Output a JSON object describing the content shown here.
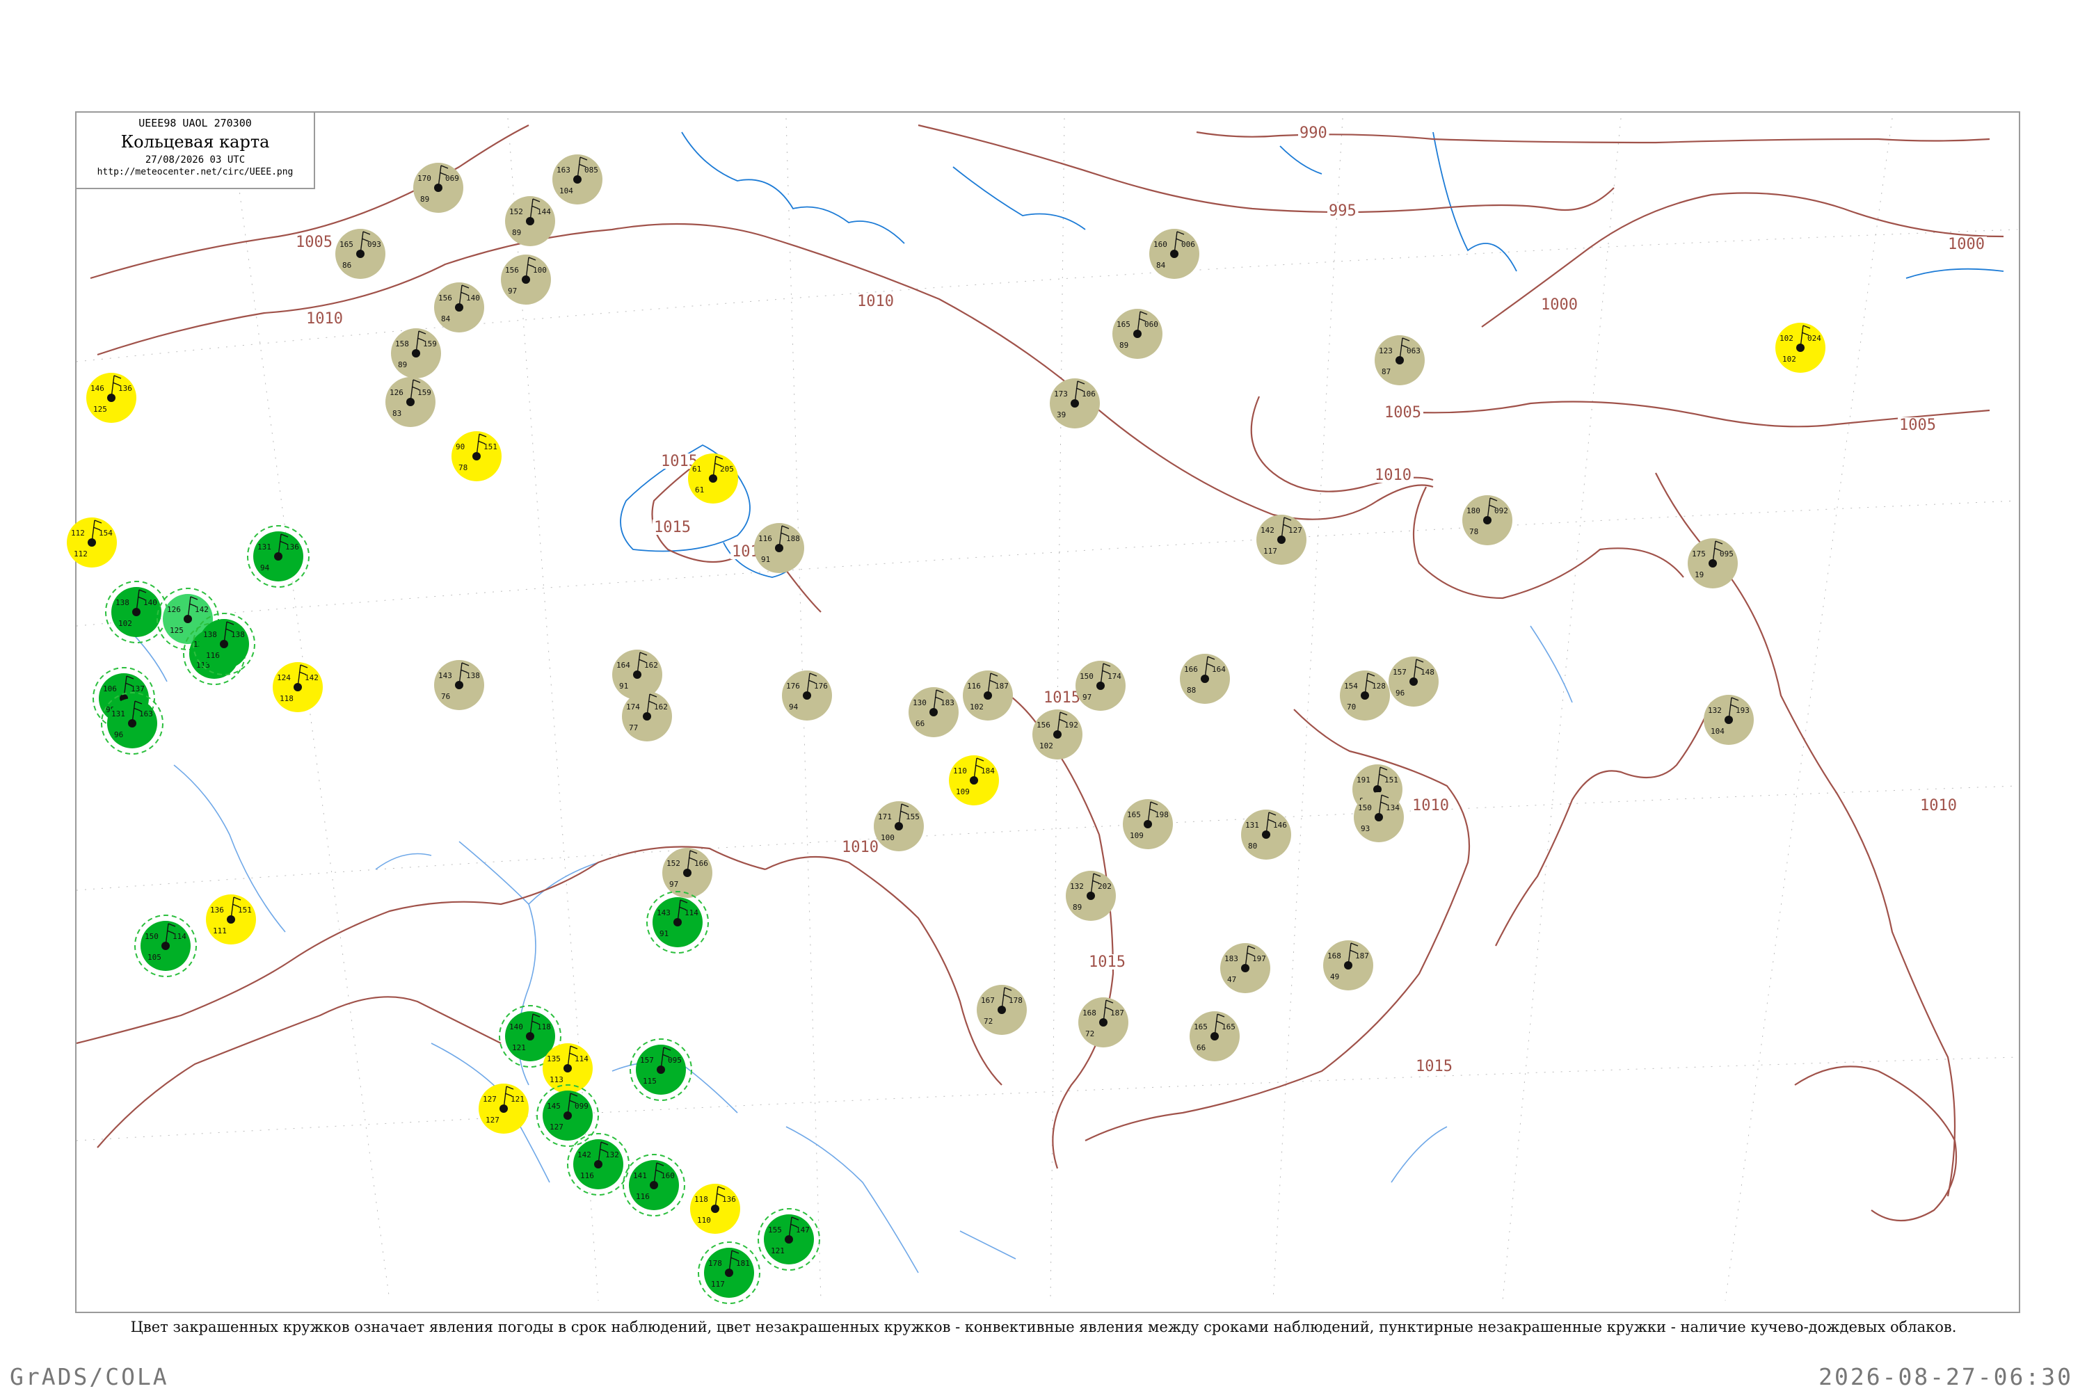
{
  "title_box": {
    "code": "UEEE98  UAOL  270300",
    "name": "Кольцевая карта",
    "date": "27/08/2026 03 UTC",
    "url": "http://meteocenter.net/circ/UEEE.png"
  },
  "caption": "Цвет закрашенных кружков означает явления погоды в срок наблюдений, цвет незакрашенных кружков - конвективные явления между сроками наблюдений, пунктирные незакрашенные кружки - наличие кучево-дождевых облаков.",
  "footer": {
    "left": "GrADS/COLA",
    "right": "2026-08-27-06:30"
  },
  "colors": {
    "isobar": "#a0524a",
    "coast": "#1c7bd6",
    "river": "#6fa8e8",
    "olive_circle": "#c4c094",
    "yellow_circle": "#fff200",
    "green_circle": "#00b026",
    "light_green_circle": "#3ed66a",
    "dashed_circle": "#2cbf3e"
  },
  "isobar_labels": [
    "990",
    "995",
    "1000",
    "1000",
    "1005",
    "1005",
    "1005",
    "1010",
    "1010",
    "1010",
    "1010",
    "1010",
    "1015",
    "1015",
    "1015",
    "1015",
    "1015",
    "1015",
    "1010"
  ],
  "stations": [
    {
      "kind": "olive",
      "p": "170",
      "t": "069",
      "td": "89"
    },
    {
      "kind": "olive",
      "p": "163",
      "t": "085",
      "td": "104"
    },
    {
      "kind": "olive",
      "p": "165",
      "t": "093",
      "td": "86"
    },
    {
      "kind": "olive",
      "p": "152",
      "t": "144",
      "td": "89"
    },
    {
      "kind": "olive",
      "p": "156",
      "t": "100",
      "td": "97"
    },
    {
      "kind": "olive",
      "p": "156",
      "t": "140",
      "td": "84"
    },
    {
      "kind": "olive",
      "p": "158",
      "t": "159",
      "td": "89"
    },
    {
      "kind": "olive",
      "p": "126",
      "t": "159",
      "td": "83"
    },
    {
      "kind": "yellow",
      "p": "90",
      "t": "151",
      "td": "78"
    },
    {
      "kind": "yellow",
      "p": "61",
      "t": "205",
      "td": "61"
    },
    {
      "kind": "olive",
      "p": "116",
      "t": "188",
      "td": "91"
    },
    {
      "kind": "olive",
      "p": "160",
      "t": "006",
      "td": "84"
    },
    {
      "kind": "olive",
      "p": "165",
      "t": "060",
      "td": "89"
    },
    {
      "kind": "olive",
      "p": "173",
      "t": "106",
      "td": "39"
    },
    {
      "kind": "olive",
      "p": "142",
      "t": "127",
      "td": "117"
    },
    {
      "kind": "olive",
      "p": "123",
      "t": "063",
      "td": "87"
    },
    {
      "kind": "yellow",
      "p": "102",
      "t": "024",
      "td": "102"
    },
    {
      "kind": "olive",
      "p": "180",
      "t": "092",
      "td": "78"
    },
    {
      "kind": "olive",
      "p": "175",
      "t": "095",
      "td": "19"
    },
    {
      "kind": "yellow",
      "p": "112",
      "t": "154",
      "td": "112"
    },
    {
      "kind": "yellow",
      "p": "146",
      "t": "136",
      "td": "125"
    },
    {
      "kind": "green",
      "p": "131",
      "t": "136",
      "td": "94"
    },
    {
      "kind": "green",
      "p": "138",
      "t": "140",
      "td": "102"
    },
    {
      "kind": "lightgreen",
      "p": "126",
      "t": "142",
      "td": "125"
    },
    {
      "kind": "green",
      "p": "132",
      "t": "135",
      "td": "113"
    },
    {
      "kind": "green",
      "p": "138",
      "t": "138",
      "td": "116"
    },
    {
      "kind": "yellow",
      "p": "124",
      "t": "142",
      "td": "118"
    },
    {
      "kind": "green",
      "p": "106",
      "t": "137",
      "td": "98"
    },
    {
      "kind": "green",
      "p": "131",
      "t": "163",
      "td": "96"
    },
    {
      "kind": "olive",
      "p": "164",
      "t": "162",
      "td": "91"
    },
    {
      "kind": "olive",
      "p": "174",
      "t": "162",
      "td": "77"
    },
    {
      "kind": "olive",
      "p": "143",
      "t": "138",
      "td": "76"
    },
    {
      "kind": "olive",
      "p": "176",
      "t": "176",
      "td": "94"
    },
    {
      "kind": "olive",
      "p": "130",
      "t": "183",
      "td": "66"
    },
    {
      "kind": "olive",
      "p": "116",
      "t": "187",
      "td": "102"
    },
    {
      "kind": "olive",
      "p": "150",
      "t": "174",
      "td": "97"
    },
    {
      "kind": "olive",
      "p": "166",
      "t": "164",
      "td": "88"
    },
    {
      "kind": "olive",
      "p": "156",
      "t": "192",
      "td": "102"
    },
    {
      "kind": "yellow",
      "p": "110",
      "t": "184",
      "td": "109"
    },
    {
      "kind": "olive",
      "p": "171",
      "t": "155",
      "td": "100"
    },
    {
      "kind": "olive",
      "p": "165",
      "t": "198",
      "td": "109"
    },
    {
      "kind": "olive",
      "p": "132",
      "t": "202",
      "td": "89"
    },
    {
      "kind": "olive",
      "p": "152",
      "t": "166",
      "td": "97"
    },
    {
      "kind": "green",
      "p": "143",
      "t": "114",
      "td": "91"
    },
    {
      "kind": "yellow",
      "p": "136",
      "t": "151",
      "td": "111"
    },
    {
      "kind": "green",
      "p": "150",
      "t": "114",
      "td": "105"
    },
    {
      "kind": "olive",
      "p": "183",
      "t": "197",
      "td": "47"
    },
    {
      "kind": "olive",
      "p": "168",
      "t": "187",
      "td": "49"
    },
    {
      "kind": "olive",
      "p": "168",
      "t": "187",
      "td": "72"
    },
    {
      "kind": "olive",
      "p": "165",
      "t": "165",
      "td": "66"
    },
    {
      "kind": "olive",
      "p": "167",
      "t": "178",
      "td": "72"
    },
    {
      "kind": "olive",
      "p": "191",
      "t": "151",
      "td": "88"
    },
    {
      "kind": "olive",
      "p": "150",
      "t": "134",
      "td": "93"
    },
    {
      "kind": "olive",
      "p": "157",
      "t": "148",
      "td": "96"
    },
    {
      "kind": "olive",
      "p": "131",
      "t": "146",
      "td": "80"
    },
    {
      "kind": "olive",
      "p": "132",
      "t": "193",
      "td": "104"
    },
    {
      "kind": "olive",
      "p": "154",
      "t": "128",
      "td": "70"
    },
    {
      "kind": "green",
      "p": "140",
      "t": "118",
      "td": "121"
    },
    {
      "kind": "yellow",
      "p": "135",
      "t": "114",
      "td": "113"
    },
    {
      "kind": "yellow",
      "p": "127",
      "t": "121",
      "td": "127"
    },
    {
      "kind": "green",
      "p": "145",
      "t": "099",
      "td": "127"
    },
    {
      "kind": "green",
      "p": "142",
      "t": "132",
      "td": "116"
    },
    {
      "kind": "green",
      "p": "141",
      "t": "160",
      "td": "116"
    },
    {
      "kind": "green",
      "p": "157",
      "t": "095",
      "td": "115"
    },
    {
      "kind": "yellow",
      "p": "118",
      "t": "136",
      "td": "110"
    },
    {
      "kind": "green",
      "p": "155",
      "t": "147",
      "td": "121"
    },
    {
      "kind": "green",
      "p": "178",
      "t": "181",
      "td": "117"
    }
  ]
}
